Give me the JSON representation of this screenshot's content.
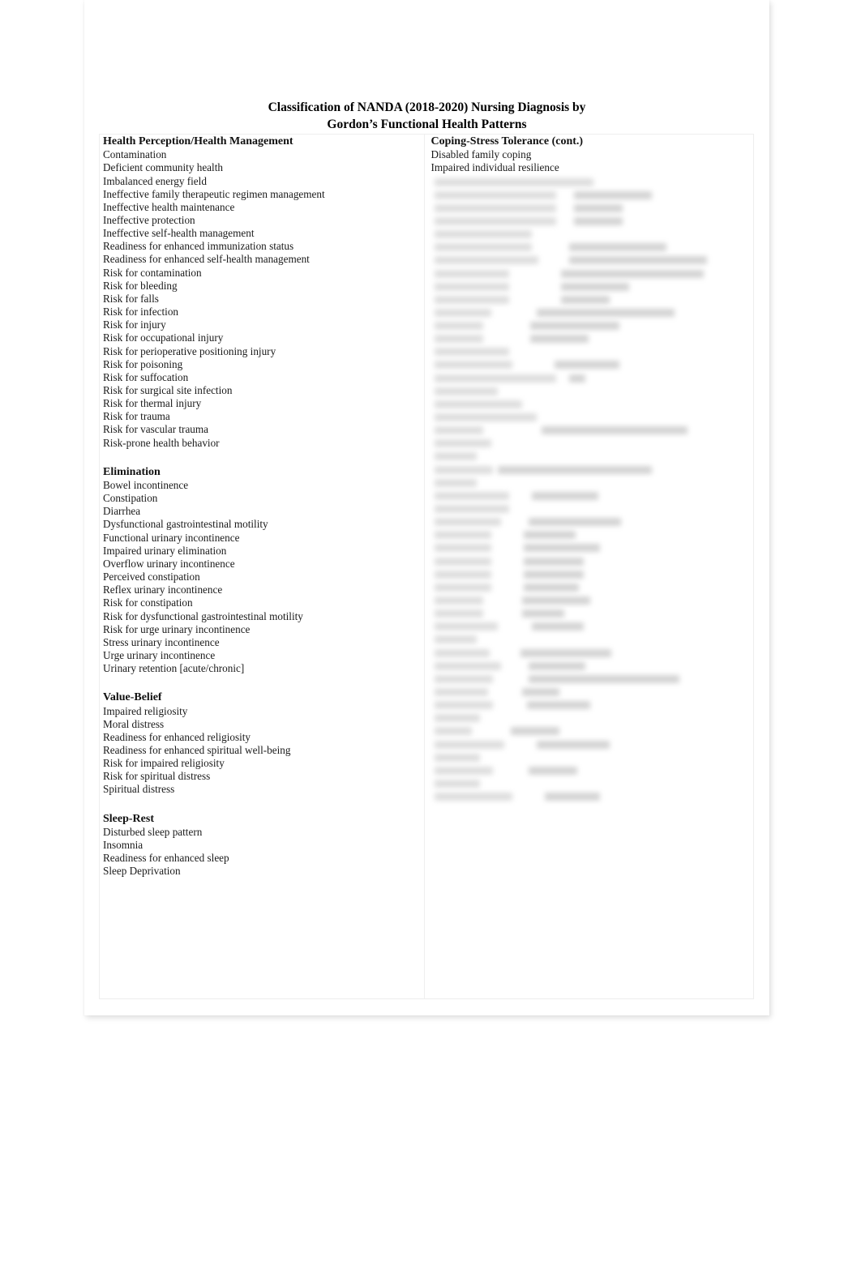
{
  "document": {
    "title_line1": "Classification of NANDA (2018-2020) Nursing Diagnosis by",
    "title_line2": "Gordon’s Functional Health Patterns"
  },
  "left_column": {
    "sections": [
      {
        "heading": "Health Perception/Health Management",
        "items": [
          "Contamination",
          "Deficient community health",
          "Imbalanced energy field",
          "Ineffective family therapeutic regimen management",
          "Ineffective health maintenance",
          "Ineffective protection",
          "Ineffective self-health management",
          "Readiness for enhanced immunization status",
          "Readiness for enhanced self-health management",
          "Risk for contamination",
          "Risk for bleeding",
          "Risk for falls",
          "Risk for infection",
          "Risk for injury",
          "Risk for occupational injury",
          "Risk for perioperative positioning injury",
          "Risk for poisoning",
          "Risk for suffocation",
          "Risk for surgical site infection",
          "Risk for thermal injury",
          "Risk for trauma",
          "Risk for vascular trauma",
          "Risk-prone health behavior"
        ]
      },
      {
        "heading": "Elimination",
        "items": [
          "Bowel incontinence",
          "Constipation",
          "Diarrhea",
          "Dysfunctional gastrointestinal motility",
          "Functional urinary incontinence",
          "Impaired urinary elimination",
          "Overflow urinary incontinence",
          "Perceived constipation",
          "Reflex urinary incontinence",
          "Risk for constipation",
          "Risk for dysfunctional gastrointestinal motility",
          "Risk for urge urinary incontinence",
          "Stress urinary incontinence",
          "Urge urinary incontinence",
          "Urinary retention [acute/chronic]"
        ]
      },
      {
        "heading": "Value-Belief",
        "items": [
          "Impaired religiosity",
          "Moral distress",
          "Readiness for enhanced religiosity",
          "Readiness for enhanced spiritual well-being",
          "Risk for impaired religiosity",
          "Risk for spiritual distress",
          "Spiritual distress"
        ]
      },
      {
        "heading": "Sleep-Rest",
        "items": [
          "Disturbed sleep pattern",
          "Insomnia",
          "Readiness for enhanced sleep",
          "Sleep Deprivation"
        ]
      }
    ]
  },
  "right_column": {
    "sections": [
      {
        "heading": "Coping-Stress Tolerance (cont.)",
        "items": [
          "Disabled family coping",
          "Impaired individual resilience"
        ]
      }
    ],
    "redacted": {
      "note": "blurred illegible text",
      "lines": [
        [
          [
            4,
            196
          ]
        ],
        [
          [
            4,
            150
          ],
          [
            176,
            96
          ]
        ],
        [
          [
            4,
            150
          ],
          [
            176,
            60
          ]
        ],
        [
          [
            4,
            150
          ],
          [
            176,
            60
          ]
        ],
        [
          [
            4,
            120
          ]
        ],
        [
          [
            4,
            120
          ],
          [
            170,
            120
          ]
        ],
        [
          [
            4,
            128
          ],
          [
            170,
            170
          ]
        ],
        [
          [
            4,
            92
          ],
          [
            160,
            176
          ]
        ],
        [
          [
            4,
            92
          ],
          [
            160,
            84
          ]
        ],
        [
          [
            4,
            92
          ],
          [
            160,
            60
          ]
        ],
        [
          [
            4,
            70
          ],
          [
            130,
            170
          ]
        ],
        [
          [
            4,
            60
          ],
          [
            122,
            110
          ]
        ],
        [
          [
            4,
            60
          ],
          [
            122,
            72
          ]
        ],
        [
          [
            4,
            92
          ]
        ],
        [
          [
            4,
            96
          ],
          [
            152,
            80
          ]
        ],
        [
          [
            4,
            150
          ],
          [
            170,
            20
          ]
        ],
        [
          [
            4,
            78
          ]
        ],
        [],
        [
          [
            4,
            108
          ]
        ],
        [
          [
            4,
            126
          ]
        ],
        [
          [
            4,
            60
          ],
          [
            136,
            180
          ]
        ],
        [
          [
            4,
            70
          ]
        ],
        [
          [
            4,
            52
          ]
        ],
        [],
        [
          [
            4,
            72
          ],
          [
            82,
            190
          ]
        ],
        [
          [
            4,
            52
          ]
        ],
        [
          [
            4,
            92
          ],
          [
            124,
            82
          ]
        ],
        [
          [
            4,
            92
          ]
        ],
        [
          [
            4,
            82
          ],
          [
            120,
            114
          ]
        ],
        [
          [
            4,
            70
          ],
          [
            114,
            64
          ]
        ],
        [
          [
            4,
            70
          ],
          [
            114,
            94
          ]
        ],
        [
          [
            4,
            70
          ],
          [
            114,
            74
          ]
        ],
        [
          [
            4,
            70
          ],
          [
            114,
            74
          ]
        ],
        [
          [
            4,
            70
          ],
          [
            114,
            68
          ]
        ],
        [
          [
            4,
            60
          ],
          [
            112,
            84
          ]
        ],
        [
          [
            4,
            60
          ],
          [
            112,
            52
          ]
        ],
        [
          [
            4,
            78
          ],
          [
            124,
            64
          ]
        ],
        [],
        [
          [
            4,
            52
          ]
        ],
        [
          [
            4,
            68
          ],
          [
            110,
            112
          ]
        ],
        [
          [
            4,
            82
          ],
          [
            120,
            70
          ]
        ],
        [
          [
            4,
            72
          ],
          [
            120,
            186
          ]
        ],
        [
          [
            4,
            66
          ],
          [
            112,
            46
          ]
        ],
        [
          [
            4,
            72
          ],
          [
            118,
            78
          ]
        ],
        [
          [
            4,
            56
          ]
        ],
        [
          [
            4,
            46
          ],
          [
            98,
            60
          ]
        ],
        [
          [
            4,
            86
          ],
          [
            130,
            90
          ]
        ],
        [
          [
            4,
            56
          ]
        ],
        [
          [
            4,
            72
          ],
          [
            120,
            60
          ]
        ],
        [
          [
            4,
            56
          ]
        ],
        [
          [
            4,
            96
          ],
          [
            140,
            68
          ]
        ]
      ]
    }
  }
}
